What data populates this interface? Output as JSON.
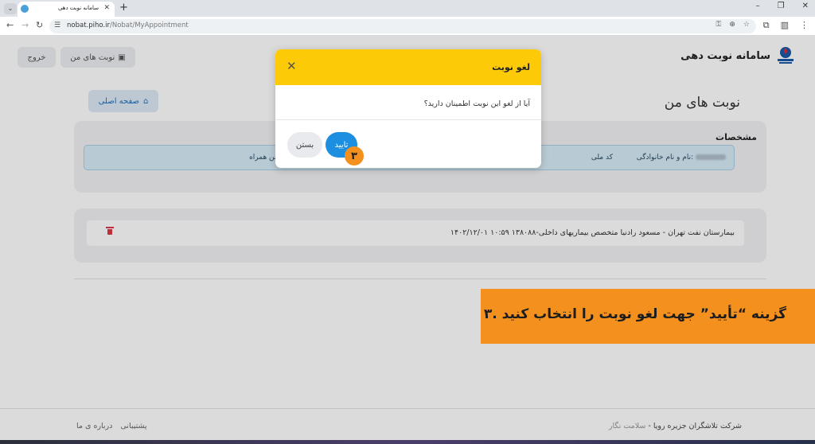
{
  "browser": {
    "tab_title": "سامانه نوبت دهی",
    "tab_close": "✕",
    "new_tab": "+",
    "url_domain": "nobat.piho.ir",
    "url_path": "/Nobat/MyAppointment",
    "window_controls": [
      "–",
      "❐",
      "✕"
    ]
  },
  "header": {
    "brand_title": "سامانه نوبت دهی",
    "my_appointments_button": "نوبت های من",
    "logout_button": "خروج"
  },
  "main": {
    "page_title": "نوبت های من",
    "home_button": "صفحه اصلی",
    "details_card": {
      "title": "مشخصات",
      "name_label": "نام و نام خانوادگی:",
      "national_code_label": "کد ملی",
      "phone_label": "تلفن همراه:"
    },
    "appointment": {
      "text": "۱۴۰۲/۱۲/۰۱ ۱۰:۵۹ بیمارستان نفت تهران - مسعود رادنیا متخصص بیماریهای داخلی-۱۳۸۰۸۸"
    }
  },
  "modal": {
    "title": "لغو نوبت",
    "message": "آیا از لغو این نوبت اطمینان دارید؟",
    "confirm_button": "تایید",
    "close_button": "بستن",
    "close_icon": "✕"
  },
  "annotation": {
    "step_number": "۳",
    "callout_text": "۳. گزینه “تأیید” جهت لغو نوبت را انتخاب کنید"
  },
  "footer": {
    "company": "شرکت تلاشگران جزیره رویا",
    "tagline": "سلامت نگار",
    "about": "درباره ی ما",
    "support": "پشتیبانی"
  },
  "colors": {
    "modal_header": "#fdca08",
    "confirm": "#1c8fe0",
    "callout": "#f4911e",
    "info_row": "#d7ecf7"
  }
}
